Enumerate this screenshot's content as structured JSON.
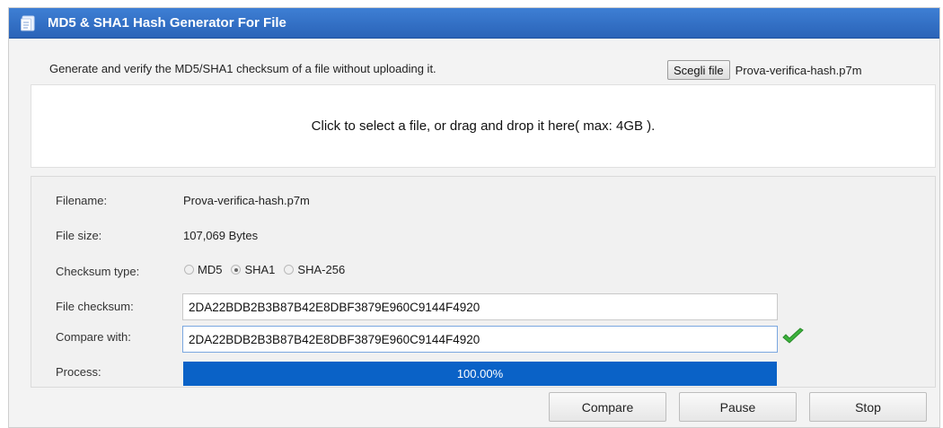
{
  "window": {
    "title": "MD5 & SHA1 Hash Generator For File",
    "icon": "document-icon"
  },
  "intro_text": "Generate and verify the MD5/SHA1 checksum of a file without uploading it.",
  "file_picker": {
    "button_label": "Scegli file",
    "selected_file": "Prova-verifica-hash.p7m"
  },
  "dropzone_text": "Click to select a file, or drag and drop it here( max: 4GB ).",
  "details": {
    "filename_label": "Filename:",
    "filename_value": "Prova-verifica-hash.p7m",
    "filesize_label": "File size:",
    "filesize_value": "107,069 Bytes",
    "checksum_type_label": "Checksum type:",
    "checksum_types": [
      {
        "label": "MD5",
        "checked": false
      },
      {
        "label": "SHA1",
        "checked": true
      },
      {
        "label": "SHA-256",
        "checked": false
      }
    ],
    "file_checksum_label": "File checksum:",
    "file_checksum_value": "2DA22BDB2B3B87B42E8DBF3879E960C9144F4920",
    "compare_label": "Compare with:",
    "compare_value": "2DA22BDB2B3B87B42E8DBF3879E960C9144F4920",
    "match_icon": "checkmark-icon",
    "process_label": "Process:",
    "progress_percent": 100,
    "progress_text": "100.00%"
  },
  "buttons": {
    "compare": "Compare",
    "pause": "Pause",
    "stop": "Stop"
  },
  "colors": {
    "titlebar": "#2f6cc3",
    "progress": "#0a62c7",
    "match_check": "#3cb33c"
  }
}
